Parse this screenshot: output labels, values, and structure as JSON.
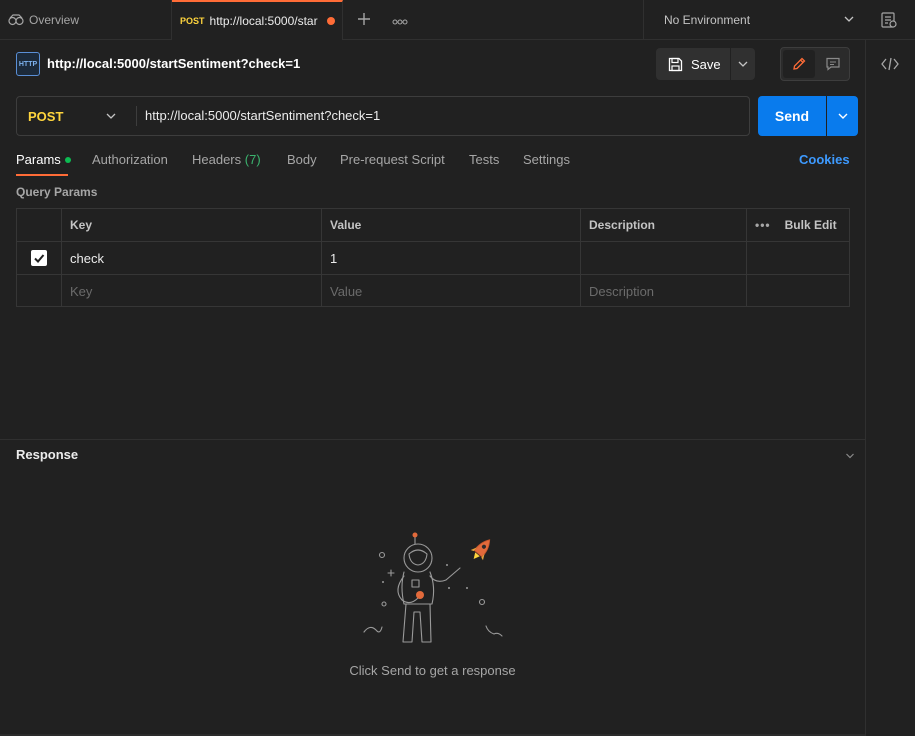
{
  "tabs": {
    "overview_label": "Overview",
    "active": {
      "method": "POST",
      "title": "http://local:5000/star"
    }
  },
  "environment": {
    "label": "No Environment"
  },
  "request": {
    "title": "http://local:5000/startSentiment?check=1",
    "save_label": "Save",
    "method": "POST",
    "url": "http://local:5000/startSentiment?check=1",
    "send_label": "Send"
  },
  "request_tabs": [
    {
      "label": "Params"
    },
    {
      "label": "Authorization"
    },
    {
      "label": "Headers",
      "count": "(7)"
    },
    {
      "label": "Body"
    },
    {
      "label": "Pre-request Script"
    },
    {
      "label": "Tests"
    },
    {
      "label": "Settings"
    }
  ],
  "cookies_label": "Cookies",
  "query_params": {
    "label": "Query Params",
    "columns": [
      "Key",
      "Value",
      "Description"
    ],
    "bulk_edit": "Bulk Edit",
    "rows": [
      {
        "checked": true,
        "key": "check",
        "value": "1",
        "description": ""
      }
    ],
    "placeholders": {
      "key": "Key",
      "value": "Value",
      "description": "Description"
    }
  },
  "response": {
    "title": "Response",
    "empty_message": "Click Send to get a response"
  },
  "colors": {
    "accent": "#ff6c37",
    "send": "#097bed",
    "method_post": "#ffd53d",
    "link": "#3d9aff"
  }
}
